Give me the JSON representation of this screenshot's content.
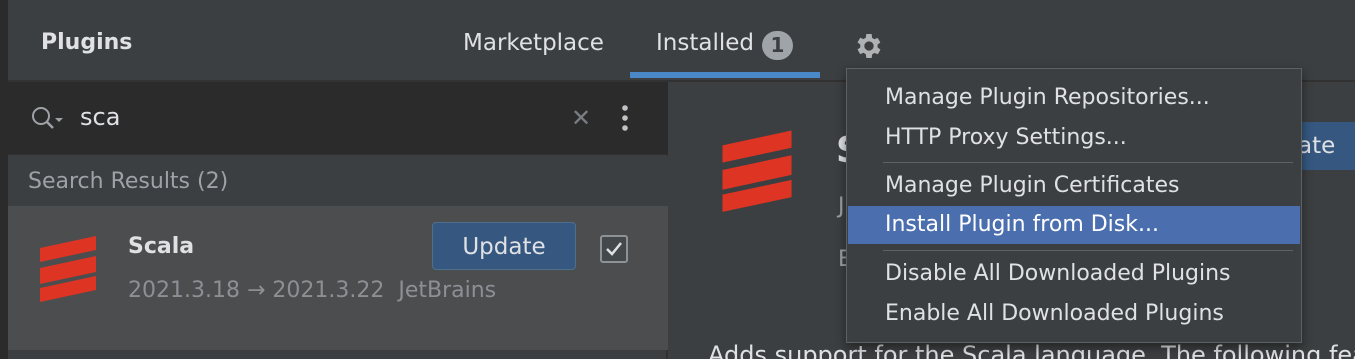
{
  "header": {
    "title": "Plugins",
    "tabs": {
      "marketplace": "Marketplace",
      "installed": "Installed",
      "installed_badge": "1"
    }
  },
  "search": {
    "value": "sca"
  },
  "results": {
    "header": "Search Results (2)",
    "plugin": {
      "name": "Scala",
      "version": "2021.3.18 → 2021.3.22",
      "vendor": "JetBrains",
      "update_label": "Update",
      "enabled": true
    }
  },
  "detail": {
    "title_fragment": "S",
    "button_fragment": "ate",
    "vendor_fragment": "J",
    "meta_fragment": "E",
    "description_fragment": "Adds support for the Scala language. The following featu"
  },
  "menu": {
    "items": [
      {
        "label": "Manage Plugin Repositories..."
      },
      {
        "label": "HTTP Proxy Settings..."
      },
      {
        "label": "Manage Plugin Certificates"
      },
      {
        "label": "Install Plugin from Disk..."
      },
      {
        "label": "Disable All Downloaded Plugins"
      },
      {
        "label": "Enable All Downloaded Plugins"
      }
    ],
    "selected_index": 3
  },
  "colors": {
    "accent": "#4a88c7",
    "button": "#365880",
    "selection": "#4b6eaf",
    "scala_red": "#de3423"
  }
}
